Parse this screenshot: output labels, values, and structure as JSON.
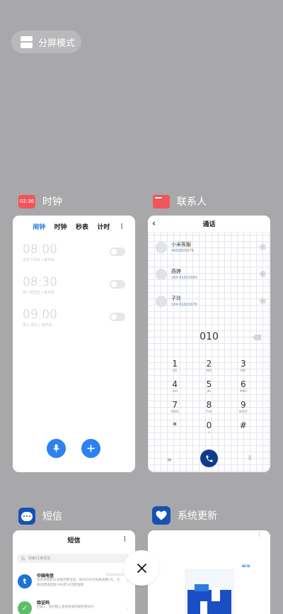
{
  "split_screen": {
    "label": "分屏模式"
  },
  "clock": {
    "app_name": "时钟",
    "icon_text": "02:36",
    "tabs": [
      {
        "label": "闹钟",
        "active": true
      },
      {
        "label": "时钟",
        "active": false
      },
      {
        "label": "秒表",
        "active": false
      },
      {
        "label": "计时",
        "active": false
      }
    ],
    "more": "⋮",
    "alarms": [
      {
        "time": "08:00",
        "desc": "法定工作日 | 未开启"
      },
      {
        "time": "08:30",
        "desc": "周一至周五 | 未开启"
      },
      {
        "time": "09:00",
        "desc": "周六 周日 | 未开启"
      }
    ]
  },
  "contacts": {
    "app_name": "联系人",
    "header_title": "通话",
    "rows": [
      {
        "name": "小米客服",
        "num_pre": "40",
        "num_hl": "010",
        "num_post": "05678"
      },
      {
        "name": "燕婷",
        "num_pre": "184 ",
        "num_hl": "010",
        "num_post": "15689"
      },
      {
        "name": "子玲",
        "num_pre": "184 ",
        "num_hl": "010",
        "num_post": "15678"
      }
    ],
    "dial_number": "010",
    "keypad": [
      {
        "digit": "1",
        "letters": "GD"
      },
      {
        "digit": "2",
        "letters": "ABC"
      },
      {
        "digit": "3",
        "letters": "DEF"
      },
      {
        "digit": "4",
        "letters": "GHI"
      },
      {
        "digit": "5",
        "letters": "JKL"
      },
      {
        "digit": "6",
        "letters": "MNO"
      },
      {
        "digit": "7",
        "letters": "PQRS"
      },
      {
        "digit": "8",
        "letters": "TUV"
      },
      {
        "digit": "9",
        "letters": "WXYZ"
      },
      {
        "digit": "*",
        "letters": ","
      },
      {
        "digit": "0",
        "letters": "+"
      },
      {
        "digit": "#",
        "letters": ""
      }
    ],
    "menu_icon": "≡",
    "pad_icon": "⠿"
  },
  "sms": {
    "app_name": "短信",
    "header_title": "短信",
    "more": "⋮",
    "search_placeholder": "搜索11条短信",
    "messages": [
      {
        "sender": "中国电信",
        "time": "2019年8月30",
        "text": "欢迎参加积分兑换话费活动，每500分可兑换话费5元，兑换话费请回复106或5#话费金额",
        "color": "#1e73d2",
        "icon_glyph": "t"
      },
      {
        "sender": "验证码",
        "time": "",
        "text": "回复1：您的网上查询登录的随机密码为",
        "color": "#5bbf6a",
        "icon_glyph": "✓"
      }
    ]
  },
  "update": {
    "app_name": "系统更新",
    "beta": "BETA",
    "dots": "⋮"
  },
  "close_button": {
    "label": "×"
  }
}
